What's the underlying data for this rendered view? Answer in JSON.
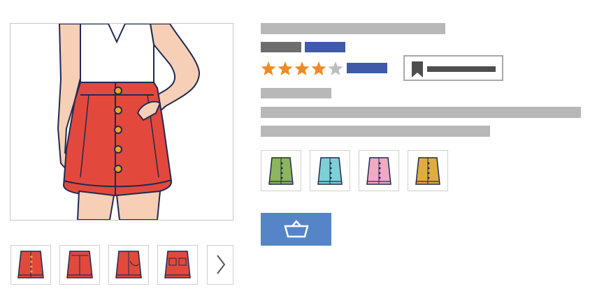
{
  "product": {
    "rating": 4,
    "rating_max": 5
  },
  "colors": {
    "main_skirt": "#e2493c",
    "outline": "#1f2a52",
    "button": "#f2a524",
    "skin": "#f6cfb6",
    "star_on": "#f08a24",
    "star_off": "#bdbdbd",
    "placeholder_gray": "#b8b8b8",
    "placeholder_dark": "#6d6d6d",
    "placeholder_blue": "#3f5aa8",
    "cart_button": "#5585c7"
  },
  "thumbnails": [
    {
      "name": "front-view",
      "active": true
    },
    {
      "name": "back-view",
      "active": false
    },
    {
      "name": "side-pocket-view",
      "active": false
    },
    {
      "name": "back-pocket-view",
      "active": false
    }
  ],
  "color_options": [
    {
      "name": "green",
      "fill": "#8db55e"
    },
    {
      "name": "cyan",
      "fill": "#7fd0d6"
    },
    {
      "name": "pink",
      "fill": "#f2a9c4"
    },
    {
      "name": "mustard",
      "fill": "#e0ac3e"
    }
  ],
  "icons": {
    "next": "chevron-right-icon",
    "wishlist": "bookmark-icon",
    "cart": "basket-icon",
    "rating": "star-icon"
  }
}
